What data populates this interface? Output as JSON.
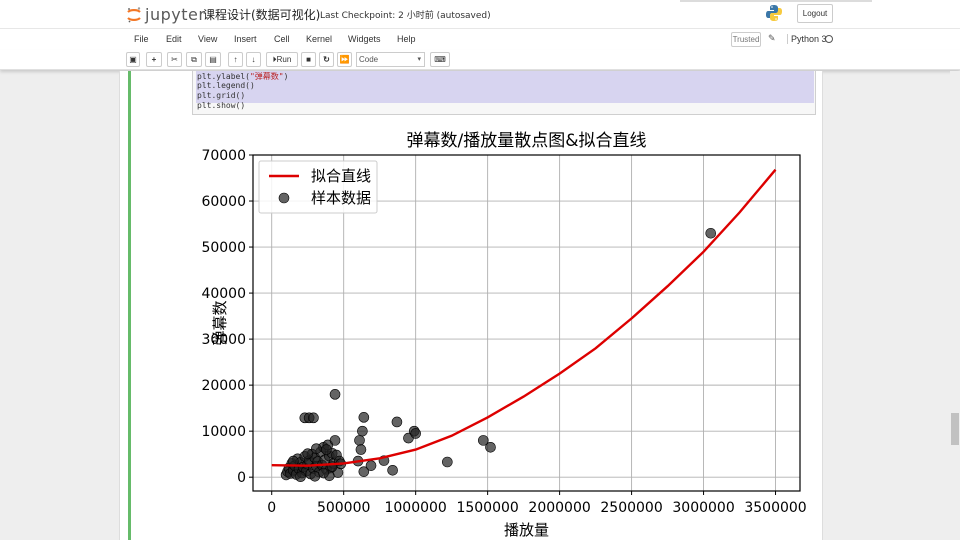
{
  "header": {
    "logo_text": "jupyter",
    "notebook_title": "课程设计(数据可视化)",
    "checkpoint": "Last Checkpoint: 2 小时前  (autosaved)",
    "logout_label": "Logout"
  },
  "menubar": {
    "items": [
      "File",
      "Edit",
      "View",
      "Insert",
      "Cell",
      "Kernel",
      "Widgets",
      "Help"
    ],
    "trusted_label": "Trusted",
    "kernel_name": "Python 3"
  },
  "toolbar": {
    "run_label": "Run",
    "cell_type": "Code"
  },
  "code_cell": {
    "lines": [
      {
        "prefix": "plt.ylabel(",
        "str": "\"弹幕数\"",
        "suffix": ")"
      },
      {
        "prefix": "plt.legend()",
        "str": "",
        "suffix": ""
      },
      {
        "prefix": "plt.grid()",
        "str": "",
        "suffix": ""
      },
      {
        "prefix": "plt.show()",
        "str": "",
        "suffix": ""
      }
    ]
  },
  "colors": {
    "fit_line": "#dd0000",
    "points": "#222222",
    "cell_bar": "#66bb6a",
    "selection": "#d7d4f0"
  },
  "chart_data": {
    "type": "scatter",
    "title": "弹幕数/播放量散点图&拟合直线",
    "xlabel": "播放量",
    "ylabel": "弹幕数",
    "xlim": [
      -130000,
      3670000
    ],
    "ylim": [
      -3000,
      70000
    ],
    "xticks": [
      0,
      500000,
      1000000,
      1500000,
      2000000,
      2500000,
      3000000,
      3500000
    ],
    "xtick_labels": [
      "0",
      "500000",
      "1000000",
      "1500000",
      "2000000",
      "2500000",
      "3000000",
      "3500000"
    ],
    "yticks": [
      0,
      10000,
      20000,
      30000,
      40000,
      50000,
      60000,
      70000
    ],
    "ytick_labels": [
      "0",
      "10000",
      "20000",
      "30000",
      "40000",
      "50000",
      "60000",
      "70000"
    ],
    "grid": true,
    "legend_position": "top-left",
    "series": [
      {
        "name": "拟合直线",
        "kind": "line",
        "x": [
          0,
          250000,
          500000,
          750000,
          1000000,
          1250000,
          1500000,
          1750000,
          2000000,
          2250000,
          2500000,
          2750000,
          3000000,
          3250000,
          3500000
        ],
        "y": [
          2600,
          2500,
          3000,
          4100,
          6000,
          9000,
          13000,
          17500,
          22500,
          28000,
          34500,
          41500,
          49000,
          57500,
          66800
        ]
      },
      {
        "name": "样本数据",
        "kind": "scatter",
        "points": [
          [
            100000,
            500
          ],
          [
            110000,
            1200
          ],
          [
            120000,
            2000
          ],
          [
            130000,
            800
          ],
          [
            140000,
            3000
          ],
          [
            150000,
            1500
          ],
          [
            160000,
            2500
          ],
          [
            170000,
            600
          ],
          [
            180000,
            4000
          ],
          [
            190000,
            1800
          ],
          [
            200000,
            3200
          ],
          [
            210000,
            900
          ],
          [
            220000,
            2200
          ],
          [
            230000,
            4500
          ],
          [
            240000,
            1300
          ],
          [
            250000,
            2800
          ],
          [
            260000,
            3600
          ],
          [
            270000,
            700
          ],
          [
            280000,
            5000
          ],
          [
            290000,
            1900
          ],
          [
            300000,
            4200
          ],
          [
            310000,
            2400
          ],
          [
            320000,
            3400
          ],
          [
            330000,
            1100
          ],
          [
            340000,
            5500
          ],
          [
            350000,
            2600
          ],
          [
            360000,
            6500
          ],
          [
            370000,
            3800
          ],
          [
            380000,
            1700
          ],
          [
            390000,
            7000
          ],
          [
            400000,
            4600
          ],
          [
            410000,
            2000
          ],
          [
            420000,
            5200
          ],
          [
            430000,
            3000
          ],
          [
            440000,
            8000
          ],
          [
            450000,
            4800
          ],
          [
            460000,
            1000
          ],
          [
            470000,
            3500
          ],
          [
            400000,
            300
          ],
          [
            300000,
            200
          ],
          [
            200000,
            100
          ],
          [
            380000,
            6000
          ],
          [
            420000,
            2300
          ],
          [
            360000,
            900
          ],
          [
            250000,
            5100
          ],
          [
            310000,
            6200
          ],
          [
            150000,
            3500
          ],
          [
            480000,
            2900
          ],
          [
            230000,
            12900
          ],
          [
            260000,
            12900
          ],
          [
            290000,
            12900
          ],
          [
            440000,
            18000
          ],
          [
            640000,
            13000
          ],
          [
            630000,
            10000
          ],
          [
            610000,
            8000
          ],
          [
            620000,
            6000
          ],
          [
            600000,
            3500
          ],
          [
            640000,
            1200
          ],
          [
            690000,
            2500
          ],
          [
            780000,
            3600
          ],
          [
            840000,
            1500
          ],
          [
            870000,
            12000
          ],
          [
            950000,
            8500
          ],
          [
            990000,
            10000
          ],
          [
            1000000,
            9500
          ],
          [
            1220000,
            3300
          ],
          [
            1470000,
            8000
          ],
          [
            1520000,
            6500
          ],
          [
            3050000,
            53000
          ]
        ]
      }
    ]
  }
}
